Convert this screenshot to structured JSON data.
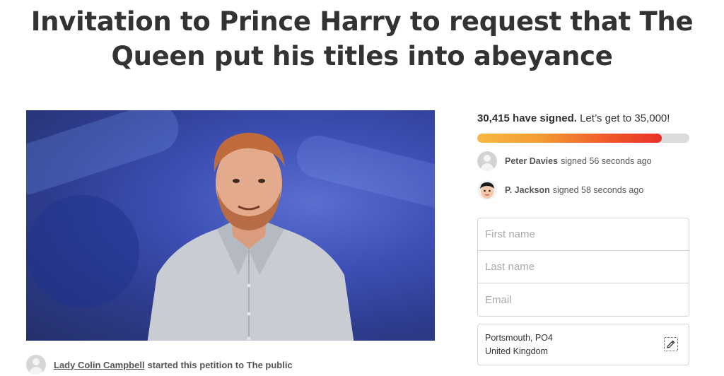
{
  "petition": {
    "title": "Invitation to Prince Harry to request that The Queen put his titles into abeyance",
    "starter_name": "Lady Colin Campbell",
    "starter_rest": "started this petition to The public"
  },
  "signatures": {
    "count": "30,415 have signed.",
    "goal_text": "Let’s get to 35,000!",
    "progress_fraction": 0.87,
    "progress_color_start": "#f6b840",
    "progress_color_end": "#e9302a",
    "recent": [
      {
        "name": "Peter Davies",
        "action": "signed 56 seconds ago",
        "avatar": "default-avatar-icon"
      },
      {
        "name": "P. Jackson",
        "action": "signed 58 seconds ago",
        "avatar": "cartoon-face-avatar"
      }
    ]
  },
  "form": {
    "first_name_placeholder": "First name",
    "last_name_placeholder": "Last name",
    "email_placeholder": "Email",
    "location_line1": "Portsmouth, PO4",
    "location_line2": "United Kingdom",
    "edit_icon": "pencil-icon"
  }
}
